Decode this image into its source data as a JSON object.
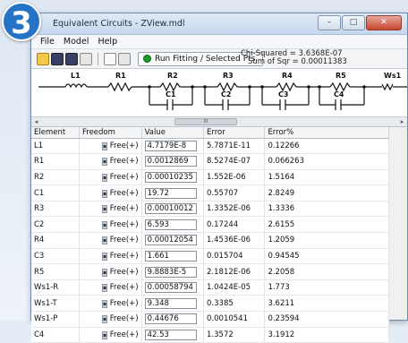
{
  "badge": "3",
  "window": {
    "title": "Equivalent Circuits - ZView.mdl"
  },
  "menu": [
    "File",
    "Model",
    "Help"
  ],
  "toolbar": {
    "run_label": "Run Fitting / Selected Pts.",
    "chi_squared": "Chi-Squared = 3.6368E-07",
    "sum_sqr": "Sum of Sqr = 0.00011383"
  },
  "circuit": {
    "labels": [
      "L1",
      "R1",
      "R2",
      "C1",
      "R3",
      "C2",
      "R4",
      "C3",
      "R5",
      "C4",
      "Ws1"
    ]
  },
  "scroll_marker": "III",
  "table": {
    "headers": [
      "Element",
      "Freedom",
      "Value",
      "Error",
      "Error%"
    ],
    "rows": [
      {
        "element": "L1",
        "freedom": "Free(+)",
        "value": "4.7179E-8",
        "error": "5.7871E-11",
        "error_pct": "0.12266"
      },
      {
        "element": "R1",
        "freedom": "Free(+)",
        "value": "0.0012869",
        "error": "8.5274E-07",
        "error_pct": "0.066263"
      },
      {
        "element": "R2",
        "freedom": "Free(+)",
        "value": "0.00010235",
        "error": "1.552E-06",
        "error_pct": "1.5164"
      },
      {
        "element": "C1",
        "freedom": "Free(+)",
        "value": "19.72",
        "error": "0.55707",
        "error_pct": "2.8249"
      },
      {
        "element": "R3",
        "freedom": "Free(+)",
        "value": "0.00010012",
        "error": "1.3352E-06",
        "error_pct": "1.3336"
      },
      {
        "element": "C2",
        "freedom": "Free(+)",
        "value": "6.593",
        "error": "0.17244",
        "error_pct": "2.6155"
      },
      {
        "element": "R4",
        "freedom": "Free(+)",
        "value": "0.00012054",
        "error": "1.4536E-06",
        "error_pct": "1.2059"
      },
      {
        "element": "C3",
        "freedom": "Free(+)",
        "value": "1.661",
        "error": "0.015704",
        "error_pct": "0.94545"
      },
      {
        "element": "R5",
        "freedom": "Free(+)",
        "value": "9.8883E-5",
        "error": "2.1812E-06",
        "error_pct": "2.2058"
      },
      {
        "element": "Ws1-R",
        "freedom": "Free(+)",
        "value": "0.00058794",
        "error": "1.0424E-05",
        "error_pct": "1.773"
      },
      {
        "element": "Ws1-T",
        "freedom": "Free(+)",
        "value": "9.348",
        "error": "0.3385",
        "error_pct": "3.6211"
      },
      {
        "element": "Ws1-P",
        "freedom": "Free(+)",
        "value": "0.44676",
        "error": "0.0010541",
        "error_pct": "0.23594"
      },
      {
        "element": "C4",
        "freedom": "Free(+)",
        "value": "42.53",
        "error": "1.3572",
        "error_pct": "3.1912"
      }
    ]
  },
  "colors": {
    "badge": "#2473c7",
    "run_dot": "#1a9a27"
  }
}
